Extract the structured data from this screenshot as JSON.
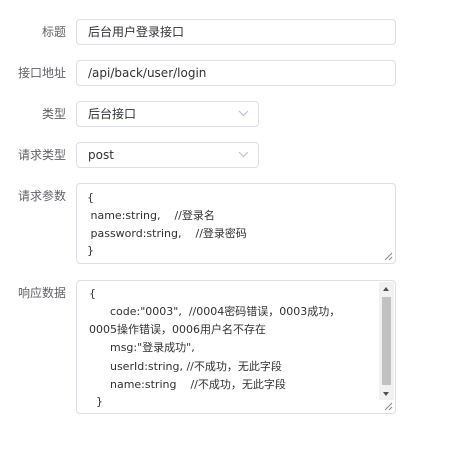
{
  "form": {
    "title": {
      "label": "标题",
      "value": "后台用户登录接口"
    },
    "url": {
      "label": "接口地址",
      "value": "/api/back/user/login"
    },
    "type": {
      "label": "类型",
      "value": "后台接口",
      "icon": "chevron-down-icon"
    },
    "method": {
      "label": "请求类型",
      "value": "post",
      "icon": "chevron-down-icon"
    },
    "params": {
      "label": "请求参数",
      "lines": [
        "{",
        " name:string,    //登录名",
        " password:string,    //登录密码",
        "}"
      ]
    },
    "response": {
      "label": "响应数据",
      "lines": [
        "{",
        "      code:\"0003\",  //0004密码错误，0003成功，",
        "0005操作错误，0006用户名不存在",
        "      msg:\"登录成功\",",
        "      userId:string, //不成功，无此字段",
        "      name:string    //不成功，无此字段",
        "  }"
      ]
    }
  }
}
